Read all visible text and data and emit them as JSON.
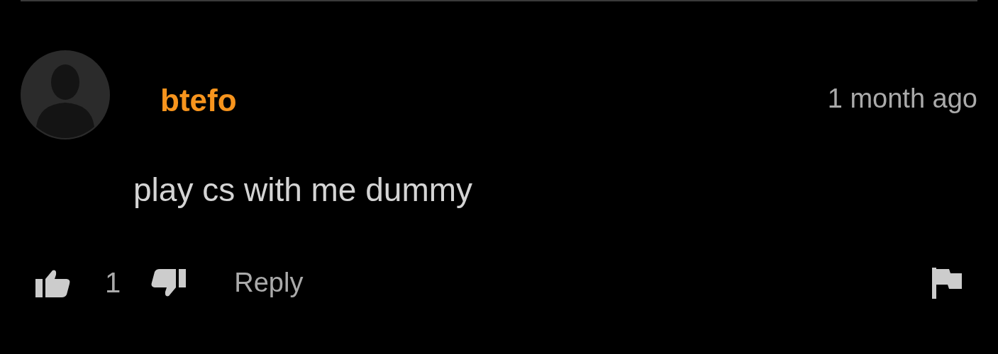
{
  "comment": {
    "author": "btefo",
    "time": "1 month ago",
    "text": "play cs with me dummy",
    "likes": "1",
    "reply": "Reply"
  }
}
